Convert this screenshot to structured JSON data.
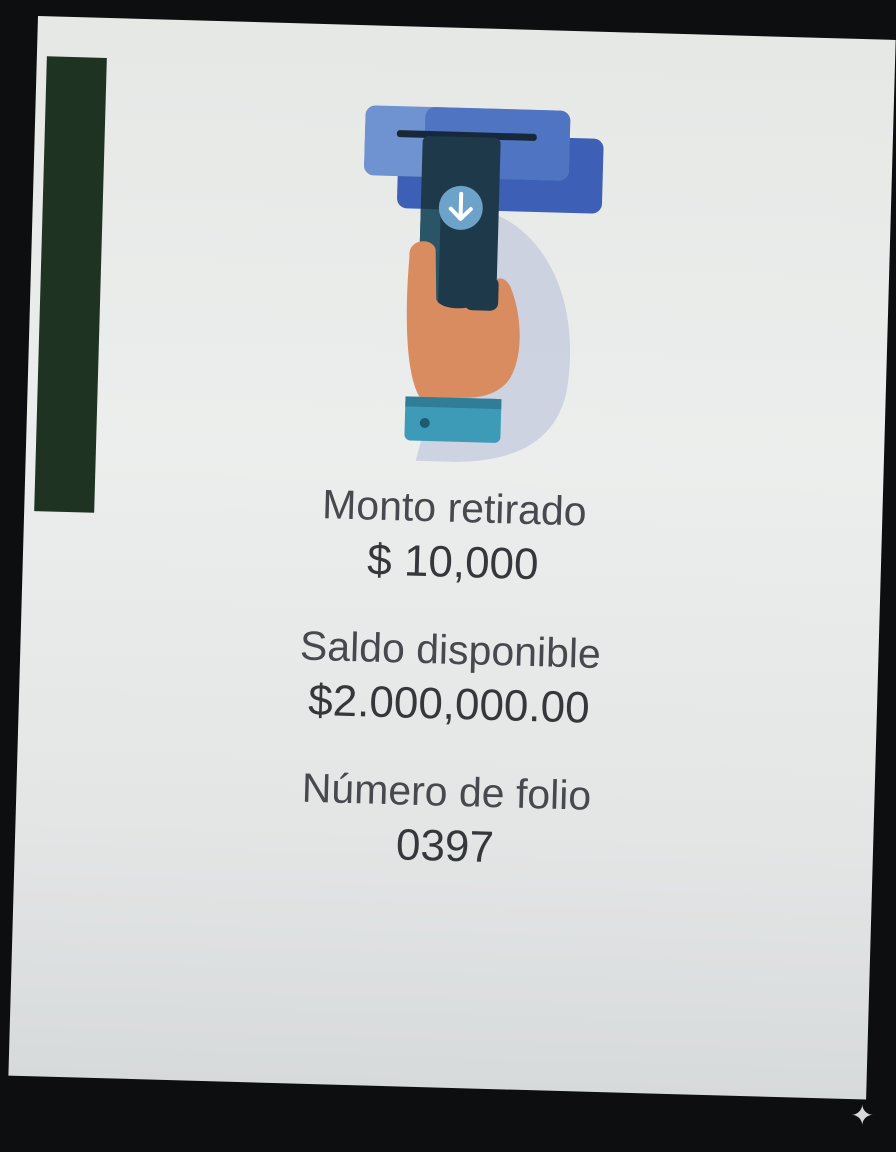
{
  "withdrawal": {
    "amount_label": "Monto retirado",
    "amount_value": "$ 10,000",
    "balance_label": "Saldo disponible",
    "balance_value": "$2.000,000.00",
    "folio_label": "Número de folio",
    "folio_value": "0397"
  },
  "icons": {
    "illustration": "atm-withdrawal-hand-icon",
    "overlay": "sparkle-icon",
    "sparkle_glyph": "✦"
  },
  "colors": {
    "screen_bg": "#e8eae9",
    "text": "#3a3d40",
    "atm_blue": "#4a78c4",
    "card_dark": "#1e3a4a",
    "hand": "#d98c5f",
    "cuff": "#3e9bb8"
  }
}
